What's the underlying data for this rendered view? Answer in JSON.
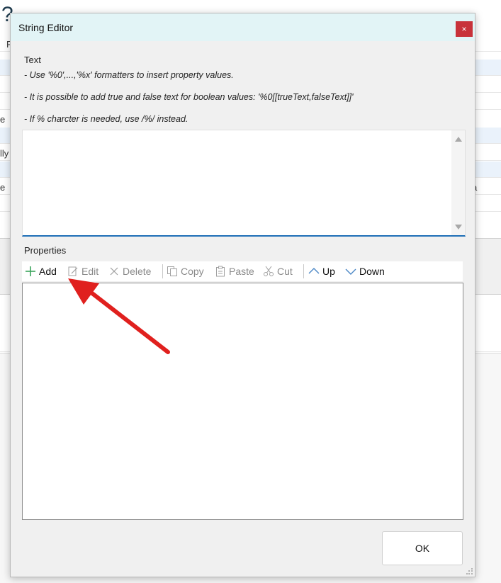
{
  "background": {
    "question_mark": "?",
    "row_letters": [
      "F",
      "e",
      "lly",
      "e",
      "a"
    ]
  },
  "dialog": {
    "title": "String Editor",
    "close_label": "×",
    "text_section_label": "Text",
    "hints": [
      "- Use '%0',...,'%x' formatters to insert property values.",
      "- It is possible to add true and false text for boolean values: '%0[[trueText,falseText]]'",
      "- If % charcter is needed, use /%/ instead."
    ],
    "text_value": "",
    "properties_label": "Properties",
    "toolbar": {
      "add": "Add",
      "edit": "Edit",
      "delete": "Delete",
      "copy": "Copy",
      "paste": "Paste",
      "cut": "Cut",
      "up": "Up",
      "down": "Down"
    },
    "ok_label": "OK"
  },
  "colors": {
    "titlebar": "#e2f4f6",
    "close": "#c8323a",
    "focus_border": "#1f6fb7",
    "annotation_arrow": "#e0201e"
  }
}
